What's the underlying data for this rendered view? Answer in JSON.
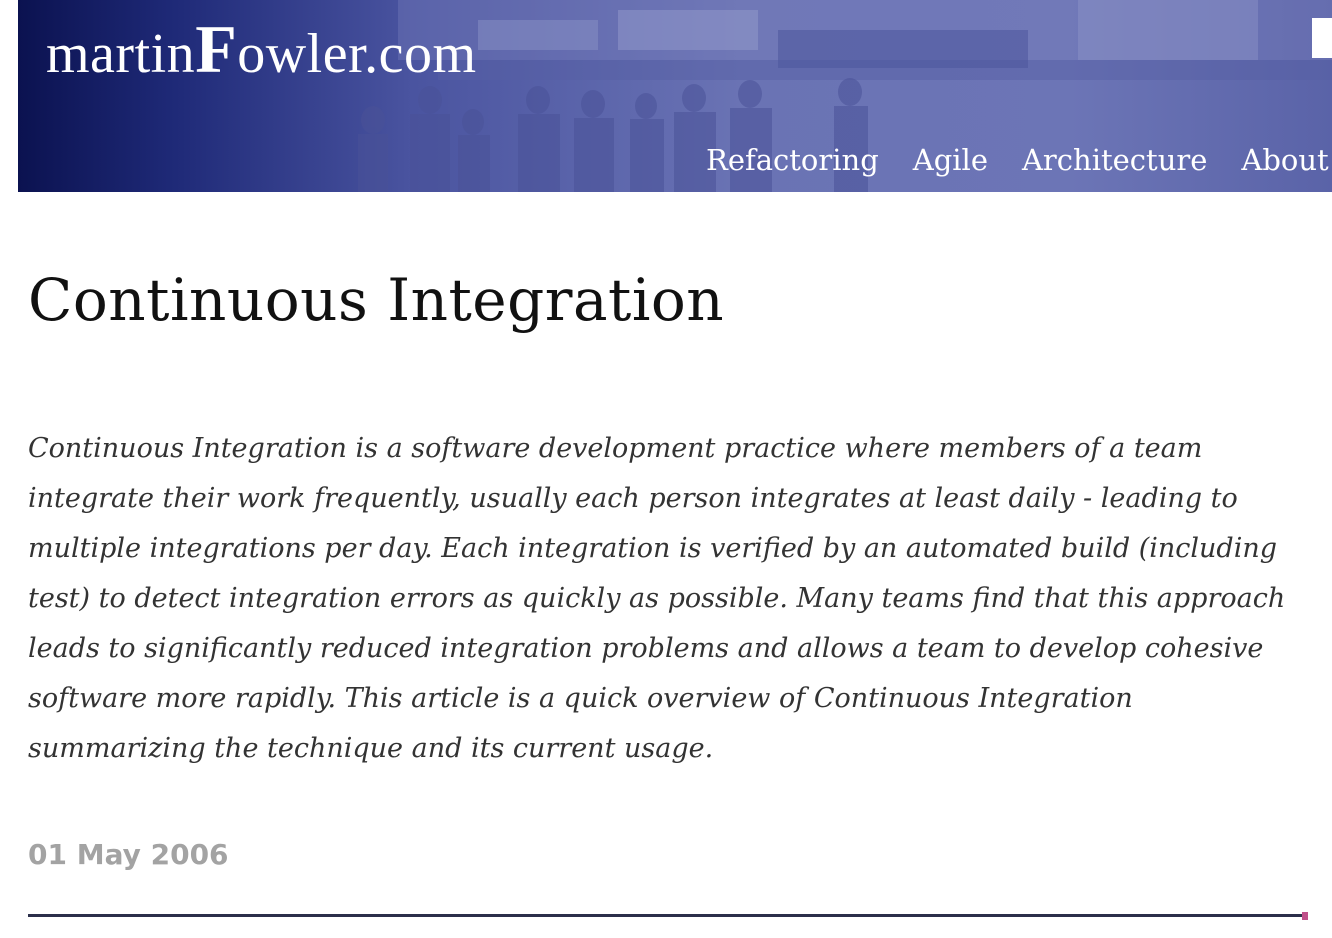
{
  "header": {
    "logo": {
      "part1": "martin",
      "part2": "F",
      "part3": "owler.com"
    },
    "nav": [
      {
        "label": "Refactoring"
      },
      {
        "label": "Agile"
      },
      {
        "label": "Architecture"
      },
      {
        "label": "About"
      }
    ]
  },
  "article": {
    "title": "Continuous Integration",
    "abstract": "Continuous Integration is a software development practice where members of a team integrate their work frequently, usually each person integrates at least daily - leading to multiple integrations per day. Each integration is verified by an automated build (including test) to detect integration errors as quickly as possible. Many teams find that this approach leads to significantly reduced integration problems and allows a team to develop cohesive software more rapidly. This article is a quick overview of Continuous Integration summarizing the technique and its current usage.",
    "date": "01 May 2006"
  },
  "colors": {
    "banner_dark": "#0b1250",
    "banner_light": "#6c75b6",
    "date_gray": "#a3a3a3"
  }
}
